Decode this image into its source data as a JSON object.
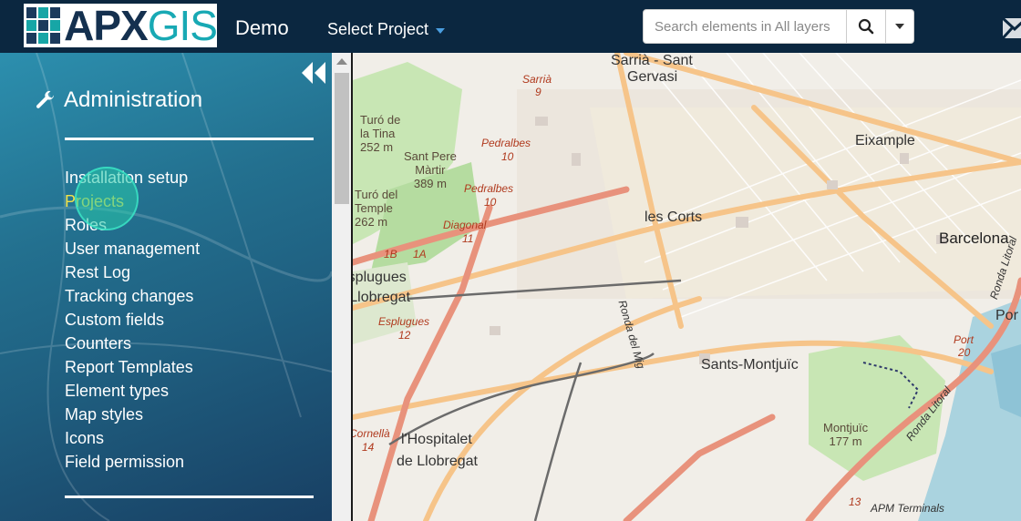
{
  "header": {
    "logo_text_a": "APX",
    "logo_text_b": "GIS",
    "app_name": "Demo",
    "project_selector": "Select Project",
    "search": {
      "placeholder": "Search elements in All layers"
    }
  },
  "sidebar": {
    "title": "Administration",
    "items": [
      {
        "label": "Installation setup"
      },
      {
        "label": "Projects",
        "active": true
      },
      {
        "label": "Roles"
      },
      {
        "label": "User management"
      },
      {
        "label": "Rest Log"
      },
      {
        "label": "Tracking changes"
      },
      {
        "label": "Custom fields"
      },
      {
        "label": "Counters"
      },
      {
        "label": "Report Templates"
      },
      {
        "label": "Element types"
      },
      {
        "label": "Map styles"
      },
      {
        "label": "Icons"
      },
      {
        "label": "Field permission"
      }
    ]
  },
  "map": {
    "labels": {
      "sarria": "Sarrià - Sant",
      "gervasi": "Gervasi",
      "sarria_road": "Sarrià",
      "sarria_road_num": "9",
      "turo_tina": "Turó de\nla Tina\n252 m",
      "pedralbes1": "Pedralbes",
      "pedralbes1_num": "10",
      "sant_pere": "Sant Pere\nMàrtir\n389 m",
      "pedralbes2": "Pedralbes",
      "pedralbes2_num": "10",
      "turo_temple": "Turó del\nTemple\n262 m",
      "diagonal": "Diagonal",
      "diagonal_num": "11",
      "eixample": "Eixample",
      "les_corts": "les Corts",
      "barcelona": "Barcelona",
      "esplugues": "Esplugues",
      "de_llobregat": "de Llobregat",
      "esplugues_road": "Esplugues",
      "esplugues_road_num": "12",
      "ronda_mig": "Ronda del Mig",
      "sants": "Sants-Montjuïc",
      "por": "Por",
      "port": "Port",
      "port_num": "20",
      "hospitalet1": "l'Hospitalet",
      "hospitalet2": "de Llobregat",
      "cornella": "Cornellà",
      "cornella_num": "14",
      "montjuic": "Montjuïc\n177 m",
      "ronda_litoral": "Ronda Litoral",
      "ronda_litoral2": "Ronda Litoral",
      "apm": "APM Terminals",
      "num_13": "13",
      "num_1b": "1B",
      "num_1a": "1A"
    }
  },
  "colors": {
    "topbar": "#0b2740",
    "sidebar_accent": "#2c8fae",
    "active_item": "#f2e24a",
    "map_bg": "#f1eee8",
    "major_road": "#f6c489",
    "motorway": "#e8927c",
    "park": "#c8e6b4",
    "water": "#aad3df"
  }
}
